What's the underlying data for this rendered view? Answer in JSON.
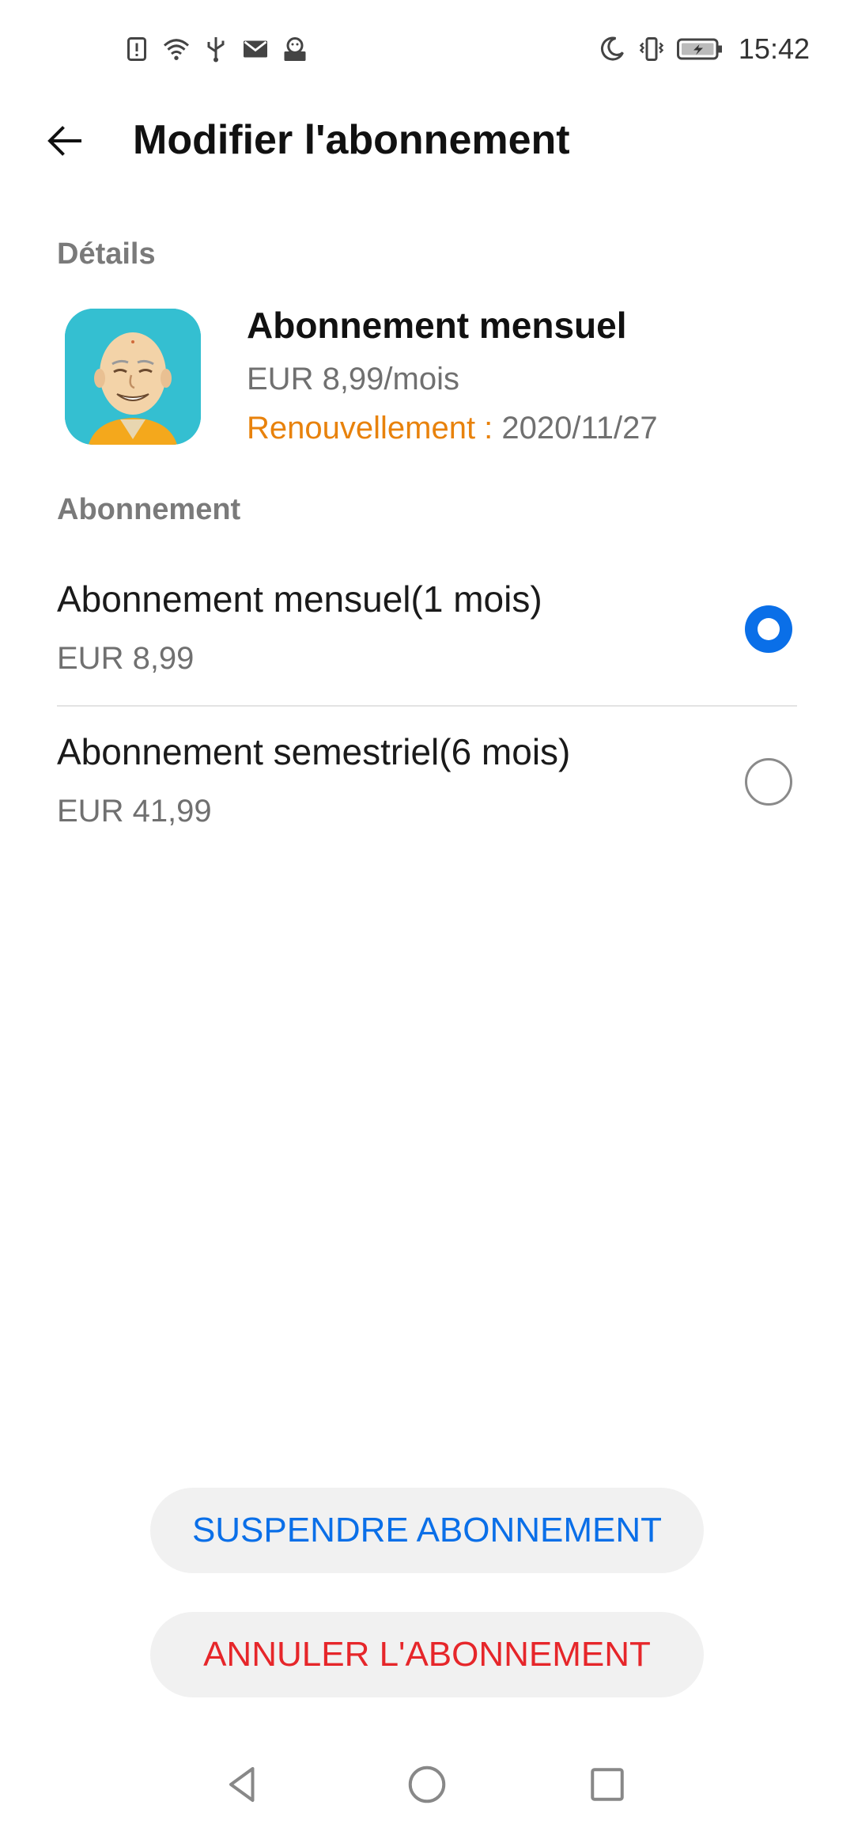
{
  "status_bar": {
    "time": "15:42",
    "left_icons": [
      "alert-icon",
      "wifi-icon",
      "usb-icon",
      "mail-icon",
      "app-notification-icon"
    ],
    "right_icons": [
      "moon-icon",
      "vibrate-icon",
      "battery-charging-icon"
    ]
  },
  "app_bar": {
    "title": "Modifier l'abonnement",
    "back_icon": "arrow-left-icon"
  },
  "details": {
    "header": "Détails",
    "name": "Abonnement mensuel",
    "price": "EUR 8,99/mois",
    "renewal_label": "Renouvellement : ",
    "renewal_date": "2020/11/27"
  },
  "subscription": {
    "header": "Abonnement",
    "options": [
      {
        "title": "Abonnement mensuel(1 mois)",
        "price": "EUR 8,99",
        "selected": true
      },
      {
        "title": "Abonnement semestriel(6 mois)",
        "price": "EUR 41,99",
        "selected": false
      }
    ]
  },
  "actions": {
    "suspend_label": "SUSPENDRE ABONNEMENT",
    "cancel_label": "ANNULER L'ABONNEMENT"
  },
  "colors": {
    "accent_blue": "#0a6fe8",
    "renewal_orange": "#e8820c",
    "danger_red": "#e6262a",
    "icon_bg": "#34bfd1"
  },
  "nav_bar": {
    "icons": [
      "nav-back-icon",
      "nav-home-icon",
      "nav-recents-icon"
    ]
  }
}
